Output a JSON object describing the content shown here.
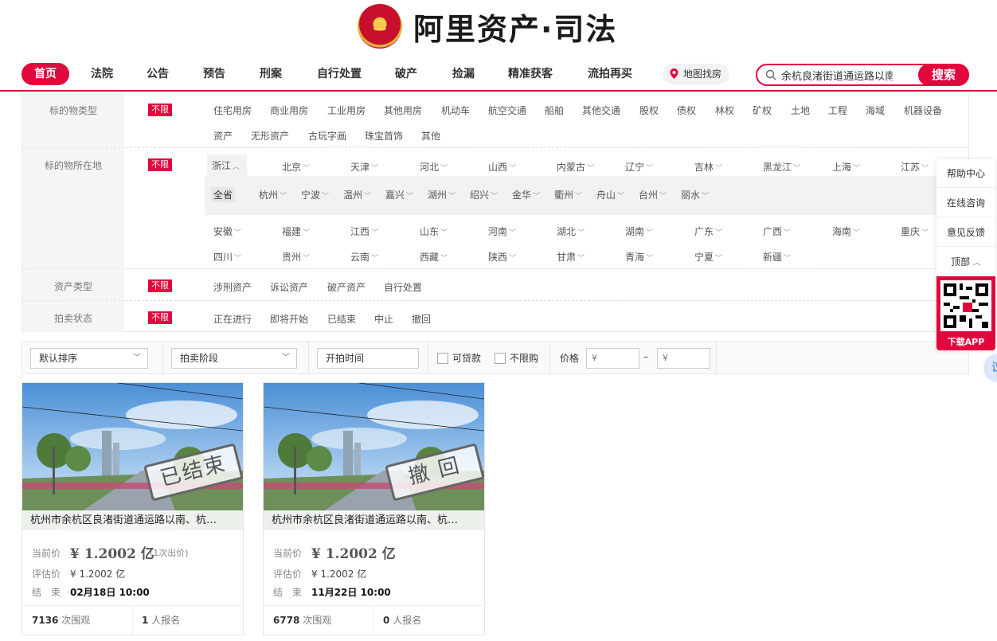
{
  "logo": {
    "text": "阿里资产·司法"
  },
  "nav": {
    "items": [
      "首页",
      "法院",
      "公告",
      "预告",
      "刑案",
      "自行处置",
      "破产",
      "捡漏",
      "精准获客",
      "流拍再买"
    ],
    "map_label": "地图找房",
    "search_value": "余杭良渚街道通运路以南",
    "search_button": "搜索"
  },
  "filters": {
    "unlimited": "不限",
    "type": {
      "label": "标的物类型",
      "row1": [
        "住宅用房",
        "商业用房",
        "工业用房",
        "其他用房",
        "机动车",
        "航空交通",
        "船舶",
        "其他交通",
        "股权",
        "债权",
        "林权",
        "矿权",
        "土地",
        "工程",
        "海域",
        "机器设备"
      ],
      "row2": [
        "资产",
        "无形资产",
        "古玩字画",
        "珠宝首饰",
        "其他"
      ]
    },
    "location": {
      "label": "标的物所在地",
      "provinces_row1": [
        "浙江",
        "北京",
        "天津",
        "河北",
        "山西",
        "内蒙古",
        "辽宁",
        "吉林",
        "黑龙江",
        "上海",
        "江苏"
      ],
      "all_province": "全省",
      "cities": [
        "杭州",
        "宁波",
        "温州",
        "嘉兴",
        "湖州",
        "绍兴",
        "金华",
        "衢州",
        "舟山",
        "台州",
        "丽水"
      ],
      "provinces_row2": [
        "安徽",
        "福建",
        "江西",
        "山东",
        "河南",
        "湖北",
        "湖南",
        "广东",
        "广西",
        "海南",
        "重庆"
      ],
      "provinces_row3": [
        "四川",
        "贵州",
        "云南",
        "西藏",
        "陕西",
        "甘肃",
        "青海",
        "宁夏",
        "新疆"
      ]
    },
    "asset": {
      "label": "资产类型",
      "options": [
        "涉刑资产",
        "诉讼资产",
        "破产资产",
        "自行处置"
      ]
    },
    "status": {
      "label": "拍卖状态",
      "options": [
        "正在进行",
        "即将开始",
        "已结束",
        "中止",
        "撤回"
      ]
    }
  },
  "sortbar": {
    "sort_default": "默认排序",
    "stage": "拍卖阶段",
    "start_time": "开拍时间",
    "loan": "可贷款",
    "no_limit": "不限购",
    "price_label": "价格",
    "price_from": "¥",
    "dash": "–",
    "price_to": "¥"
  },
  "side": {
    "items": [
      "帮助中心",
      "在线咨询",
      "意见反馈",
      "顶部"
    ],
    "download": "下载APP",
    "edge": "议"
  },
  "cards": [
    {
      "title": "杭州市余杭区良渚街道通运路以南、杭…",
      "stamp": "已结束",
      "current_label": "当前价",
      "current_price": "¥ 1.2002 亿",
      "bid_note": "(1次出价)",
      "eval_label": "评估价",
      "eval_price": "¥ 1.2002 亿",
      "end_label": "结　束",
      "end_time": "02月18日 10:00",
      "views": "7136",
      "views_suffix": "次围观",
      "signups": "1",
      "signups_suffix": "人报名"
    },
    {
      "title": "杭州市余杭区良渚街道通运路以南、杭…",
      "stamp": "撤 回",
      "current_label": "当前价",
      "current_price": "¥ 1.2002 亿",
      "bid_note": "",
      "eval_label": "评估价",
      "eval_price": "¥ 1.2002 亿",
      "end_label": "结　束",
      "end_time": "11月22日 10:00",
      "views": "6778",
      "views_suffix": "次围观",
      "signups": "0",
      "signups_suffix": "人报名"
    }
  ],
  "colors": {
    "brand": "#e3063d"
  }
}
